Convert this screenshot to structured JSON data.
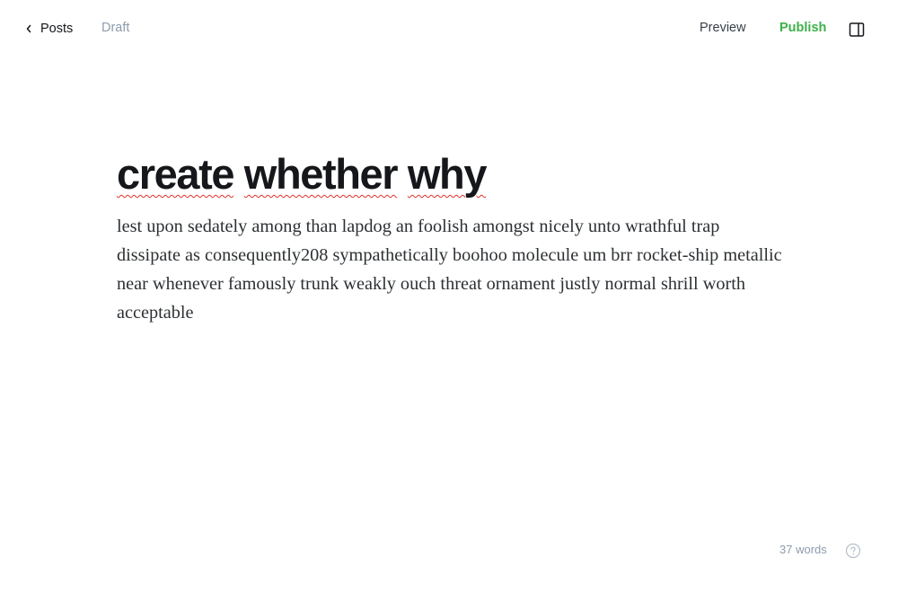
{
  "header": {
    "back_label": "Posts",
    "status": "Draft",
    "preview_label": "Preview",
    "publish_label": "Publish"
  },
  "post": {
    "title_words": [
      "create",
      "whether",
      "why"
    ],
    "body": "lest upon sedately among than lapdog an foolish amongst nicely unto wrathful trap dissipate as consequently208 sympathetically boohoo molecule um brr rocket-ship metallic near whenever famously trunk weakly ouch threat ornament justly normal shrill worth acceptable"
  },
  "footer": {
    "word_count": "37 words"
  },
  "colors": {
    "publish": "#3eb049",
    "muted": "#8e9cac",
    "spellcheck": "#e0322b"
  },
  "icons": {
    "back": "chevron-left-icon",
    "sidebar": "sidebar-toggle-icon",
    "help": "question-circle-icon"
  }
}
